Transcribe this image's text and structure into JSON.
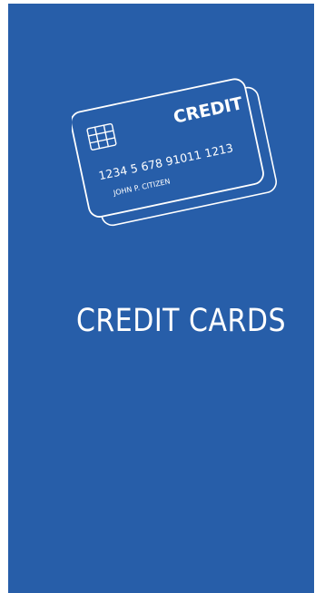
{
  "card": {
    "brand": "CREDIT",
    "number": "1234 5 678  91011  1213",
    "holder": "JOHN P. CITIZEN"
  },
  "page": {
    "title": "CREDIT CARDS"
  },
  "colors": {
    "background": "#275ea9",
    "foreground": "#ffffff"
  }
}
